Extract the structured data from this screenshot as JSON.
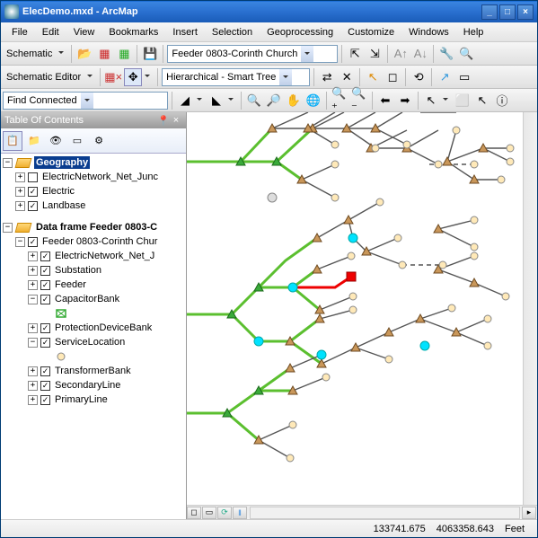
{
  "app": {
    "title": "ElecDemo.mxd - ArcMap"
  },
  "menu": [
    "File",
    "Edit",
    "View",
    "Bookmarks",
    "Insert",
    "Selection",
    "Geoprocessing",
    "Customize",
    "Windows",
    "Help"
  ],
  "tb1": {
    "schematic": "Schematic",
    "combo": "Feeder 0803-Corinth Church"
  },
  "tb2": {
    "editor": "Schematic Editor",
    "combo": "Hierarchical - Smart Tree"
  },
  "tb3": {
    "combo": "Find Connected"
  },
  "toc": {
    "title": "Table Of Contents",
    "df1": "Geography",
    "l1": "ElectricNetwork_Net_Junc",
    "l2": "Electric",
    "l3": "Landbase",
    "df2": "Data frame Feeder 0803-C",
    "f1": "Feeder 0803-Corinth Chur",
    "f2": "ElectricNetwork_Net_J",
    "f3": "Substation",
    "f4": "Feeder",
    "f5": "CapacitorBank",
    "f6": "ProtectionDeviceBank",
    "f7": "ServiceLocation",
    "f8": "TransformerBank",
    "f9": "SecondaryLine",
    "f10": "PrimaryLine"
  },
  "status": {
    "x": "133741.675",
    "y": "4063358.643",
    "unit": "Feet"
  }
}
